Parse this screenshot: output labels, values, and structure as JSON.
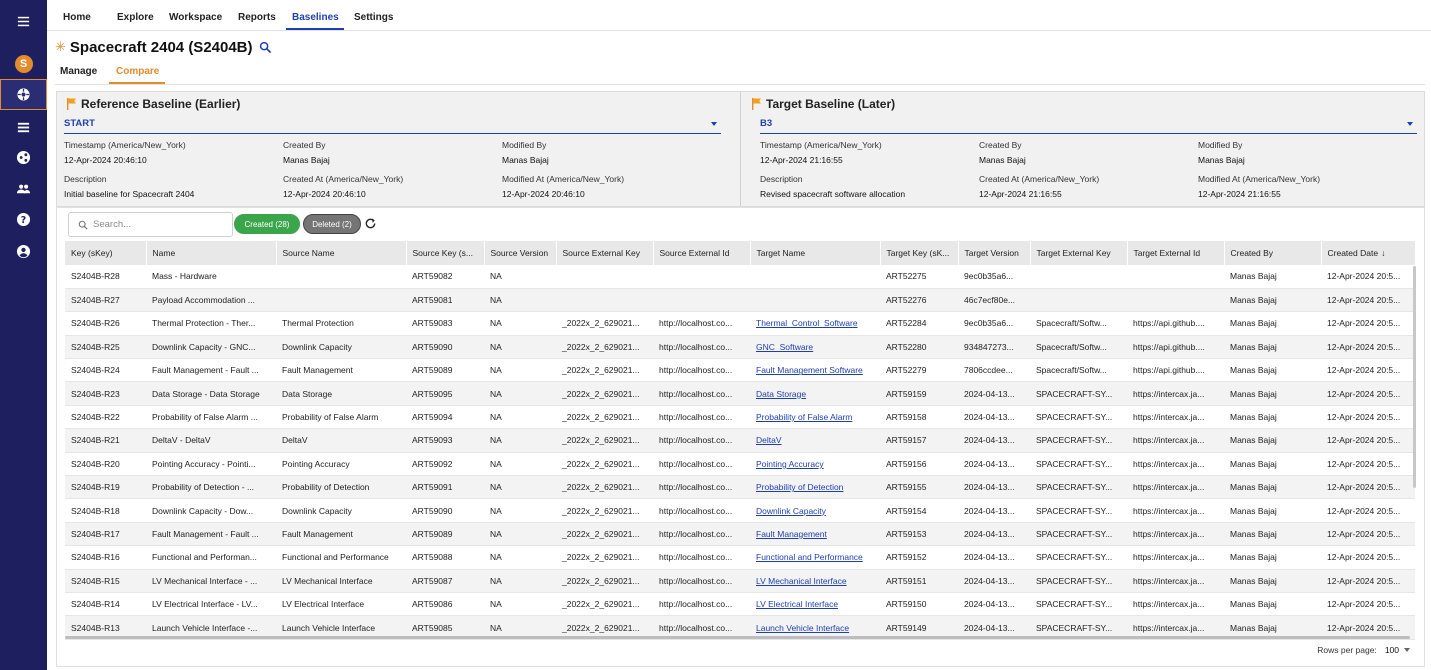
{
  "nav": {
    "tabs": [
      "Home",
      "Explore",
      "Workspace",
      "Reports",
      "Baselines",
      "Settings"
    ],
    "active_tab": "Baselines"
  },
  "sidebar": {
    "items": [
      "menu-icon",
      "logo",
      "baseline-icon",
      "list-icon",
      "share-icon",
      "users-icon",
      "help-icon",
      "account-icon"
    ],
    "logo_letter": "S"
  },
  "page": {
    "title": "Spacecraft 2404 (S2404B)",
    "subtabs": [
      "Manage",
      "Compare"
    ],
    "active_subtab": "Compare"
  },
  "reference": {
    "title": "Reference Baseline (Earlier)",
    "selected": "START",
    "timestamp_label": "Timestamp (America/New_York)",
    "timestamp": "12-Apr-2024 20:46:10",
    "created_by_label": "Created By",
    "created_by": "Manas Bajaj",
    "modified_by_label": "Modified By",
    "modified_by": "Manas Bajaj",
    "description_label": "Description",
    "description": "Initial baseline for Spacecraft 2404",
    "created_at_label": "Created At (America/New_York)",
    "created_at": "12-Apr-2024 20:46:10",
    "modified_at_label": "Modified At (America/New_York)",
    "modified_at": "12-Apr-2024 20:46:10"
  },
  "target": {
    "title": "Target Baseline (Later)",
    "selected": "B3",
    "timestamp_label": "Timestamp (America/New_York)",
    "timestamp": "12-Apr-2024 21:16:55",
    "created_by_label": "Created By",
    "created_by": "Manas Bajaj",
    "modified_by_label": "Modified By",
    "modified_by": "Manas Bajaj",
    "description_label": "Description",
    "description": "Revised spacecraft software allocation",
    "created_at_label": "Created At (America/New_York)",
    "created_at": "12-Apr-2024 21:16:55",
    "modified_at_label": "Modified At (America/New_York)",
    "modified_at": "12-Apr-2024 21:16:55"
  },
  "toolbar": {
    "search_placeholder": "Search...",
    "created_chip": "Created (28)",
    "deleted_chip": "Deleted (2)"
  },
  "table": {
    "columns": [
      "Key (sKey)",
      "Name",
      "Source Name",
      "Source Key (s...",
      "Source Version",
      "Source External Key",
      "Source External Id",
      "Target Name",
      "Target Key (sK...",
      "Target Version",
      "Target External Key",
      "Target External Id",
      "Created By",
      "Created Date"
    ],
    "rows": [
      [
        "S2404B-R28",
        "Mass - Hardware",
        "",
        "ART59082",
        "NA",
        "",
        "",
        "",
        "ART52275",
        "9ec0b35a6...",
        "",
        "",
        "Manas Bajaj",
        "12-Apr-2024 20:5..."
      ],
      [
        "S2404B-R27",
        "Payload Accommodation ...",
        "",
        "ART59081",
        "NA",
        "",
        "",
        "",
        "ART52276",
        "46c7ecf80e...",
        "",
        "",
        "Manas Bajaj",
        "12-Apr-2024 20:5..."
      ],
      [
        "S2404B-R26",
        "Thermal Protection - Ther...",
        "Thermal Protection",
        "ART59083",
        "NA",
        "_2022x_2_629021...",
        "http://localhost.co...",
        "Thermal_Control_Software",
        "ART52284",
        "9ec0b35a6...",
        "Spacecraft/Softw...",
        "https://api.github....",
        "Manas Bajaj",
        "12-Apr-2024 20:5..."
      ],
      [
        "S2404B-R25",
        "Downlink Capacity - GNC...",
        "Downlink Capacity",
        "ART59090",
        "NA",
        "_2022x_2_629021...",
        "http://localhost.co...",
        "GNC_Software",
        "ART52280",
        "934847273...",
        "Spacecraft/Softw...",
        "https://api.github....",
        "Manas Bajaj",
        "12-Apr-2024 20:5..."
      ],
      [
        "S2404B-R24",
        "Fault Management - Fault ...",
        "Fault Management",
        "ART59089",
        "NA",
        "_2022x_2_629021...",
        "http://localhost.co...",
        "Fault Management Software",
        "ART52279",
        "7806ccdee...",
        "Spacecraft/Softw...",
        "https://api.github....",
        "Manas Bajaj",
        "12-Apr-2024 20:5..."
      ],
      [
        "S2404B-R23",
        "Data Storage - Data Storage",
        "Data Storage",
        "ART59095",
        "NA",
        "_2022x_2_629021...",
        "http://localhost.co...",
        "Data Storage",
        "ART59159",
        "2024-04-13...",
        "SPACECRAFT-SY...",
        "https://intercax.ja...",
        "Manas Bajaj",
        "12-Apr-2024 20:5..."
      ],
      [
        "S2404B-R22",
        "Probability of False Alarm ...",
        "Probability of False Alarm",
        "ART59094",
        "NA",
        "_2022x_2_629021...",
        "http://localhost.co...",
        "Probability of False Alarm",
        "ART59158",
        "2024-04-13...",
        "SPACECRAFT-SY...",
        "https://intercax.ja...",
        "Manas Bajaj",
        "12-Apr-2024 20:5..."
      ],
      [
        "S2404B-R21",
        "DeltaV - DeltaV",
        "DeltaV",
        "ART59093",
        "NA",
        "_2022x_2_629021...",
        "http://localhost.co...",
        "DeltaV",
        "ART59157",
        "2024-04-13...",
        "SPACECRAFT-SY...",
        "https://intercax.ja...",
        "Manas Bajaj",
        "12-Apr-2024 20:5..."
      ],
      [
        "S2404B-R20",
        "Pointing Accuracy - Pointi...",
        "Pointing Accuracy",
        "ART59092",
        "NA",
        "_2022x_2_629021...",
        "http://localhost.co...",
        "Pointing Accuracy",
        "ART59156",
        "2024-04-13...",
        "SPACECRAFT-SY...",
        "https://intercax.ja...",
        "Manas Bajaj",
        "12-Apr-2024 20:5..."
      ],
      [
        "S2404B-R19",
        "Probability of Detection - ...",
        "Probability of Detection",
        "ART59091",
        "NA",
        "_2022x_2_629021...",
        "http://localhost.co...",
        "Probability of Detection",
        "ART59155",
        "2024-04-13...",
        "SPACECRAFT-SY...",
        "https://intercax.ja...",
        "Manas Bajaj",
        "12-Apr-2024 20:5..."
      ],
      [
        "S2404B-R18",
        "Downlink Capacity - Dow...",
        "Downlink Capacity",
        "ART59090",
        "NA",
        "_2022x_2_629021...",
        "http://localhost.co...",
        "Downlink Capacity",
        "ART59154",
        "2024-04-13...",
        "SPACECRAFT-SY...",
        "https://intercax.ja...",
        "Manas Bajaj",
        "12-Apr-2024 20:5..."
      ],
      [
        "S2404B-R17",
        "Fault Management - Fault ...",
        "Fault Management",
        "ART59089",
        "NA",
        "_2022x_2_629021...",
        "http://localhost.co...",
        "Fault Management",
        "ART59153",
        "2024-04-13...",
        "SPACECRAFT-SY...",
        "https://intercax.ja...",
        "Manas Bajaj",
        "12-Apr-2024 20:5..."
      ],
      [
        "S2404B-R16",
        "Functional and Performan...",
        "Functional and Performance",
        "ART59088",
        "NA",
        "_2022x_2_629021...",
        "http://localhost.co...",
        "Functional and Performance",
        "ART59152",
        "2024-04-13...",
        "SPACECRAFT-SY...",
        "https://intercax.ja...",
        "Manas Bajaj",
        "12-Apr-2024 20:5..."
      ],
      [
        "S2404B-R15",
        "LV Mechanical Interface - ...",
        "LV Mechanical Interface",
        "ART59087",
        "NA",
        "_2022x_2_629021...",
        "http://localhost.co...",
        "LV Mechanical Interface",
        "ART59151",
        "2024-04-13...",
        "SPACECRAFT-SY...",
        "https://intercax.ja...",
        "Manas Bajaj",
        "12-Apr-2024 20:5..."
      ],
      [
        "S2404B-R14",
        "LV Electrical Interface - LV...",
        "LV Electrical Interface",
        "ART59086",
        "NA",
        "_2022x_2_629021...",
        "http://localhost.co...",
        "LV Electrical Interface",
        "ART59150",
        "2024-04-13...",
        "SPACECRAFT-SY...",
        "https://intercax.ja...",
        "Manas Bajaj",
        "12-Apr-2024 20:5..."
      ],
      [
        "S2404B-R13",
        "Launch Vehicle Interface -...",
        "Launch Vehicle Interface",
        "ART59085",
        "NA",
        "_2022x_2_629021...",
        "http://localhost.co...",
        "Launch Vehicle Interface",
        "ART59149",
        "2024-04-13...",
        "SPACECRAFT-SY...",
        "https://intercax.ja...",
        "Manas Bajaj",
        "12-Apr-2024 20:5..."
      ]
    ]
  },
  "pager": {
    "label": "Rows per page:",
    "value": "100"
  }
}
